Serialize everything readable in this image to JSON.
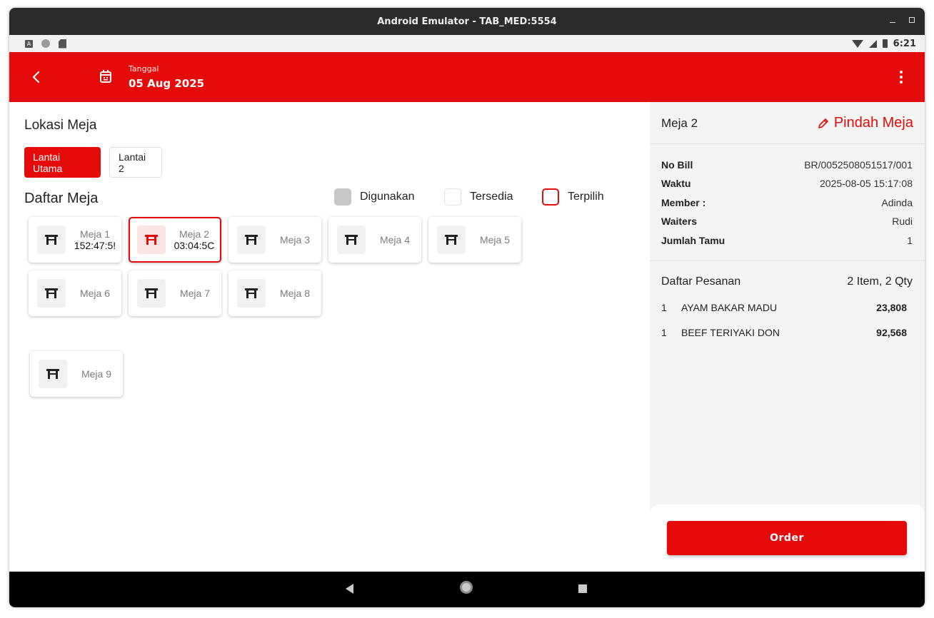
{
  "window": {
    "title": "Android Emulator - TAB_MED:5554"
  },
  "status_bar": {
    "time": "6:21"
  },
  "app_bar": {
    "date_label": "Tanggal",
    "date_value": "05 Aug 2025"
  },
  "left": {
    "title": "Lokasi Meja",
    "floors": [
      "Lantai Utama",
      "Lantai 2"
    ],
    "list_title": "Daftar Meja",
    "legend": [
      "Digunakan",
      "Tersedia",
      "Terpilih"
    ],
    "tables": [
      {
        "name": "Meja 1",
        "timer": "152:47:5!"
      },
      {
        "name": "Meja 2",
        "timer": "03:04:5C"
      },
      {
        "name": "Meja 3"
      },
      {
        "name": "Meja 4"
      },
      {
        "name": "Meja 5"
      },
      {
        "name": "Meja 6"
      },
      {
        "name": "Meja 7"
      },
      {
        "name": "Meja 8"
      },
      {
        "name": "Meja 9"
      }
    ]
  },
  "right": {
    "table_name": "Meja 2",
    "move_label": "Pindah Meja",
    "info": [
      {
        "key": "No Bill",
        "value": "BR/0052508051517/001"
      },
      {
        "key": "Waktu",
        "value": "2025-08-05 15:17:08"
      },
      {
        "key": "Member :",
        "value": "Adinda"
      },
      {
        "key": "Waiters",
        "value": "Rudi"
      },
      {
        "key": "Jumlah Tamu",
        "value": "1"
      }
    ],
    "orders_title": "Daftar Pesanan",
    "orders_summary": "2 Item, 2 Qty",
    "orders": [
      {
        "qty": "1",
        "name": "AYAM BAKAR MADU",
        "price": "23,808"
      },
      {
        "qty": "1",
        "name": "BEEF TERIYAKI DON",
        "price": "92,568"
      }
    ],
    "order_button": "Order"
  },
  "colors": {
    "primary": "#e50b0b",
    "used": "#c7c7c7"
  }
}
